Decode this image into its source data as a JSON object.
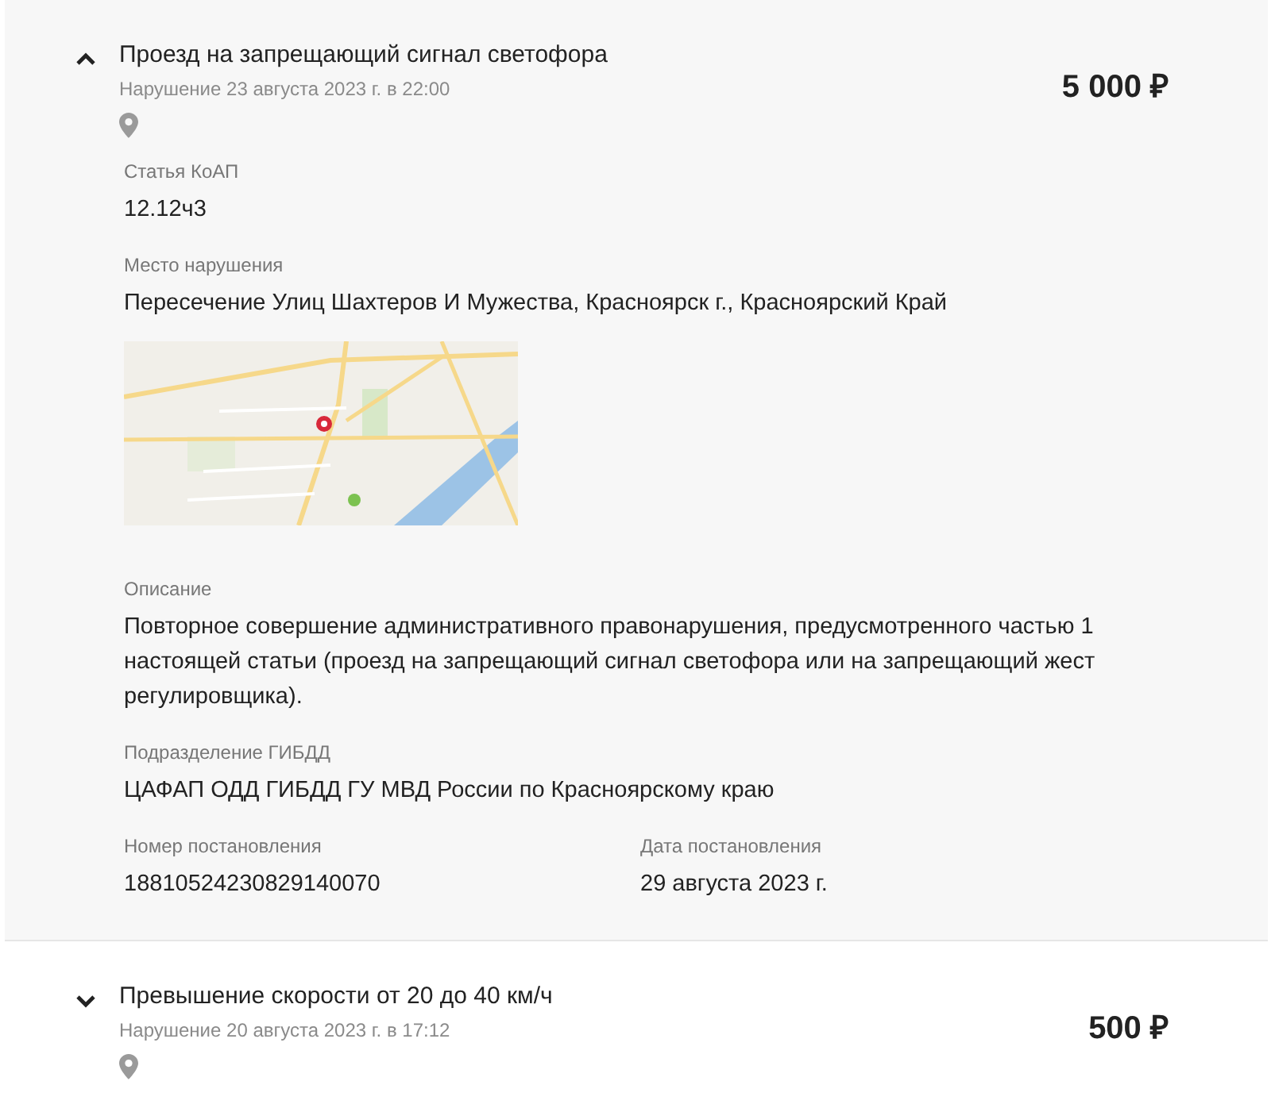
{
  "fines": [
    {
      "title": "Проезд на запрещающий сигнал светофора",
      "date": "Нарушение 23 августа 2023 г. в 22:00",
      "amount": "5 000 ₽",
      "expanded": true,
      "details": [
        {
          "kind": "field",
          "label": "Статья КоАП",
          "value": "12.12ч3"
        },
        {
          "kind": "field",
          "label": "Место нарушения",
          "value": "Пересечение Улиц Шахтеров И Мужества, Красноярск г., Красноярский Край"
        },
        {
          "kind": "picture"
        },
        {
          "kind": "field",
          "label": "Описание",
          "value": "Повторное совершение административного правонарушения, предусмотренного частью 1 настоящей статьи (проезд на запрещающий сигнал светофора или на запрещающий жест регулировщика)."
        },
        {
          "kind": "field",
          "label": "Подразделение ГИБДД",
          "value": "ЦАФАП ОДД ГИБДД ГУ МВД России по Красноярскому краю"
        },
        {
          "kind": "pair",
          "fields": [
            {
              "label": "Номер постановления",
              "value": "18810524230829140070"
            },
            {
              "label": "Дата постановления",
              "value": "29 августа 2023 г."
            }
          ]
        }
      ]
    },
    {
      "title": "Превышение скорости от 20 до 40 км/ч",
      "date": "Нарушение 20 августа 2023 г. в 17:12",
      "amount": "500 ₽",
      "expanded": false
    }
  ]
}
